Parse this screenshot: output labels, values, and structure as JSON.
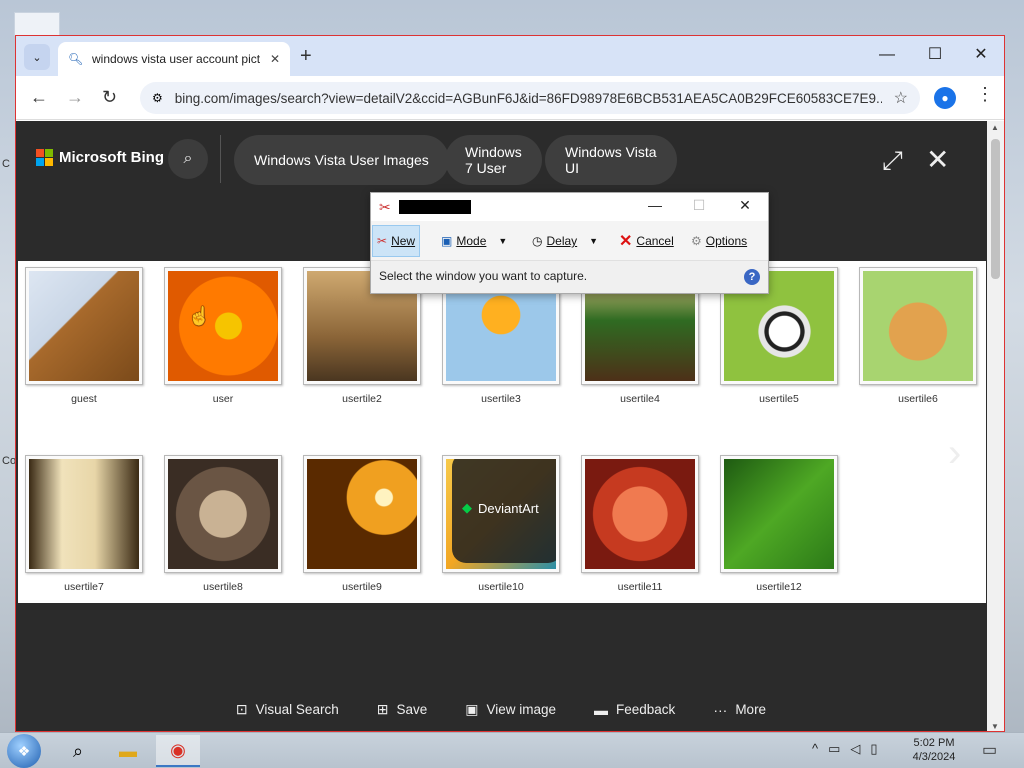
{
  "desktop": {
    "left_labels": [
      "C",
      "Co"
    ]
  },
  "browser": {
    "tab": {
      "title": "windows vista user account pict"
    },
    "url": "bing.com/images/search?view=detailV2&ccid=AGBunF6J&id=86FD98978E6BCB531AEA5CA0B29FCE60583CE7E9...",
    "window_controls": {
      "minimize": "—",
      "maximize": "☐",
      "close": "✕"
    }
  },
  "bing": {
    "logo_text": "Microsoft Bing",
    "pills": [
      {
        "line1": "Windows Vista User Images",
        "line2": ""
      },
      {
        "line1": "Windows",
        "line2": "7 User"
      },
      {
        "line1": "Windows Vista",
        "line2": "UI"
      }
    ],
    "tiles": [
      {
        "caption": "guest"
      },
      {
        "caption": "user"
      },
      {
        "caption": "usertile2"
      },
      {
        "caption": "usertile3"
      },
      {
        "caption": "usertile4"
      },
      {
        "caption": "usertile5"
      },
      {
        "caption": "usertile6"
      },
      {
        "caption": "usertile7"
      },
      {
        "caption": "usertile8"
      },
      {
        "caption": "usertile9"
      },
      {
        "caption": "usertile10"
      },
      {
        "caption": "usertile11"
      },
      {
        "caption": "usertile12"
      }
    ],
    "watermark": "DeviantArt",
    "bottom_actions": [
      "Visual Search",
      "Save",
      "View image",
      "Feedback",
      "More"
    ]
  },
  "snipping_tool": {
    "buttons": {
      "new": "New",
      "mode": "Mode",
      "delay": "Delay",
      "cancel": "Cancel",
      "options": "Options"
    },
    "status": "Select the window you want to capture.",
    "help": "?"
  },
  "taskbar": {
    "time": "5:02 PM",
    "date": "4/3/2024"
  },
  "colors": {
    "bing_bg": "#2b2b2b",
    "accent": "#1a73e8",
    "window_border": "#dd3333"
  }
}
